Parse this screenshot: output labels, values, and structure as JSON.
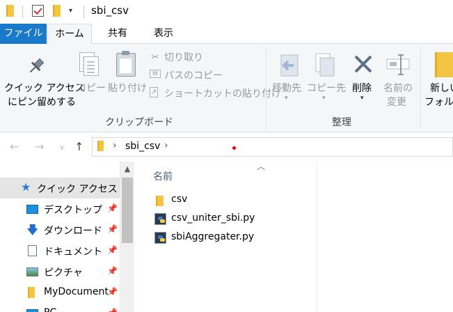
{
  "window": {
    "title": "sbi_csv"
  },
  "ribbon_tabs": {
    "file": "ファイル",
    "home": "ホーム",
    "share": "共有",
    "view": "表示"
  },
  "ribbon": {
    "pin_line1": "クイック アクセス",
    "pin_line2": "にピン留めする",
    "copy": "コピー",
    "paste": "貼り付け",
    "cut": "切り取り",
    "copy_path": "パスのコピー",
    "paste_shortcut": "ショートカットの貼り付け",
    "group_clipboard": "クリップボード",
    "move_to": "移動先",
    "copy_to": "コピー先",
    "delete": "削除",
    "rename_line1": "名前の",
    "rename_line2": "変更",
    "new_folder_line1": "新しい",
    "new_folder_line2": "フォルダー",
    "group_organize": "整理"
  },
  "address": {
    "path": "sbi_csv"
  },
  "nav_pane": {
    "items": [
      {
        "label": "クイック アクセス",
        "icon": "star-icon"
      },
      {
        "label": "デスクトップ",
        "icon": "desktop-icon"
      },
      {
        "label": "ダウンロード",
        "icon": "download-icon"
      },
      {
        "label": "ドキュメント",
        "icon": "document-icon"
      },
      {
        "label": "ピクチャ",
        "icon": "picture-icon"
      },
      {
        "label": "MyDocument",
        "icon": "folder-icon"
      },
      {
        "label": "PC",
        "icon": "pc-icon"
      }
    ]
  },
  "file_list": {
    "column_name": "名前",
    "files": [
      {
        "name": "csv",
        "type": "folder"
      },
      {
        "name": "csv_uniter_sbi.py",
        "type": "python"
      },
      {
        "name": "sbiAggregater.py",
        "type": "python"
      }
    ]
  },
  "colors": {
    "accent": "#1979ca",
    "ribbon_bg": "#f5f6f7",
    "folder": "#f4c542"
  }
}
